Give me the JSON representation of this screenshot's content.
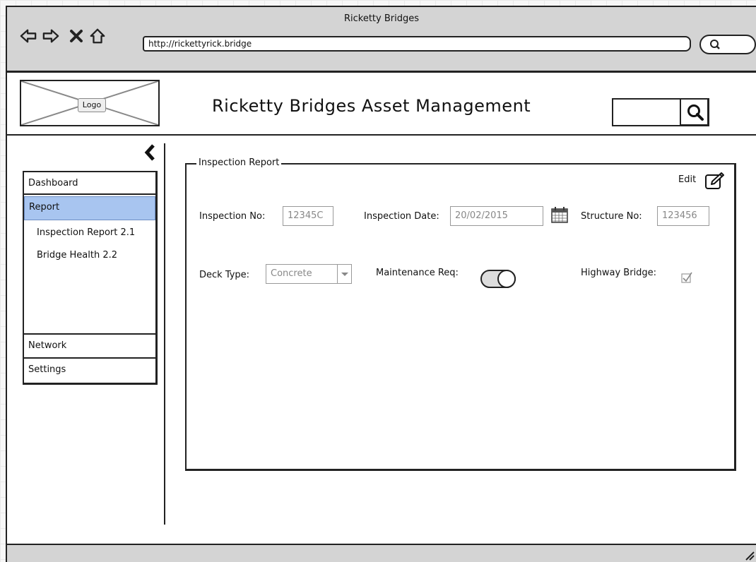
{
  "browser": {
    "title": "Ricketty Bridges",
    "url": "http://rickettyrick.bridge"
  },
  "header": {
    "logo_label": "Logo",
    "app_title": "Ricketty Bridges Asset Management",
    "search_placeholder": ""
  },
  "sidebar": {
    "items": [
      {
        "label": "Dashboard",
        "active": false
      },
      {
        "label": "Report",
        "active": true
      },
      {
        "label": "Network",
        "active": false
      },
      {
        "label": "Settings",
        "active": false
      }
    ],
    "subitems": [
      {
        "label": "Inspection Report 2.1"
      },
      {
        "label": "Bridge Health 2.2"
      }
    ]
  },
  "report": {
    "legend": "Inspection Report",
    "edit_label": "Edit",
    "inspection_no_label": "Inspection No:",
    "inspection_no_value": "12345C",
    "inspection_date_label": "Inspection Date:",
    "inspection_date_value": "20/02/2015",
    "structure_no_label": "Structure No:",
    "structure_no_value": "123456",
    "deck_type_label": "Deck Type:",
    "deck_type_value": "Concrete",
    "maintenance_label": "Maintenance Req:",
    "maintenance_on": true,
    "highway_label": "Highway Bridge:",
    "highway_checked": true
  },
  "colors": {
    "active_nav": "#a8c5f0",
    "chrome": "#d4d4d4"
  }
}
